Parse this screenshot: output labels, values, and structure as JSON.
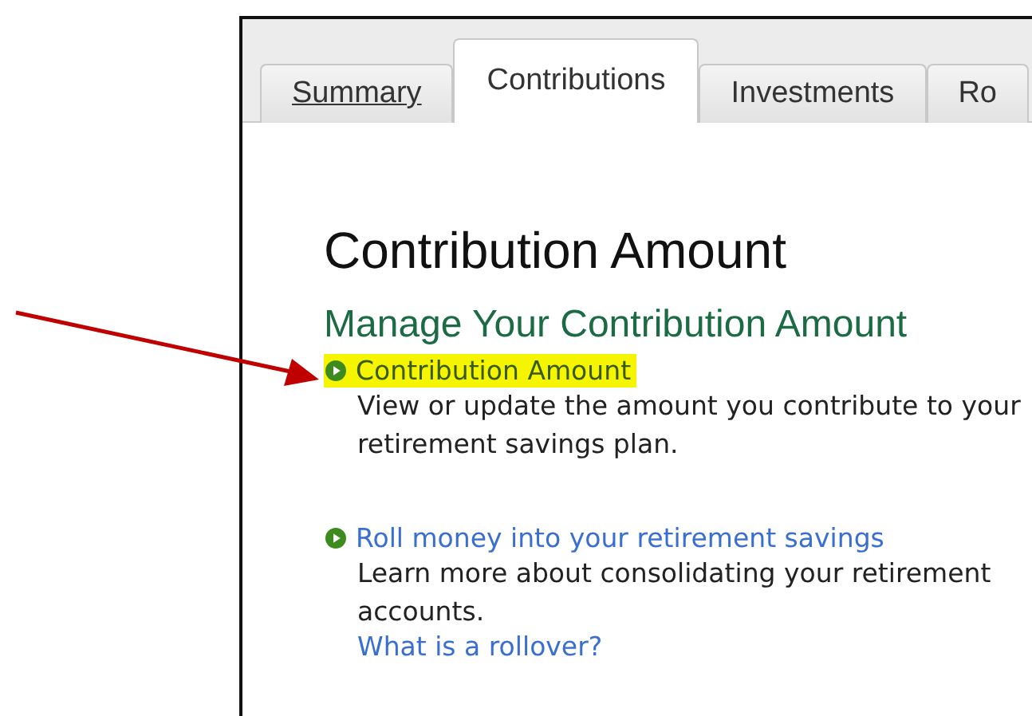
{
  "tabs": [
    {
      "label": "Summary",
      "selected": false,
      "underlined": true
    },
    {
      "label": "Contributions",
      "selected": true,
      "underlined": false
    },
    {
      "label": "Investments",
      "selected": false,
      "underlined": false
    },
    {
      "label": "Ro",
      "selected": false,
      "underlined": false
    }
  ],
  "heading": "Contribution Amount",
  "subheading": "Manage Your Contribution Amount",
  "links": [
    {
      "title": "Contribution Amount",
      "highlighted": true,
      "description": "View or update the amount you contribute to your retirement savings plan."
    },
    {
      "title": "Roll money into your retirement savings",
      "highlighted": false,
      "description": "Learn more about consolidating your retirement accounts.",
      "extra_link": "What is a rollover?"
    }
  ],
  "annotation": {
    "kind": "arrow",
    "color": "#c00000"
  }
}
